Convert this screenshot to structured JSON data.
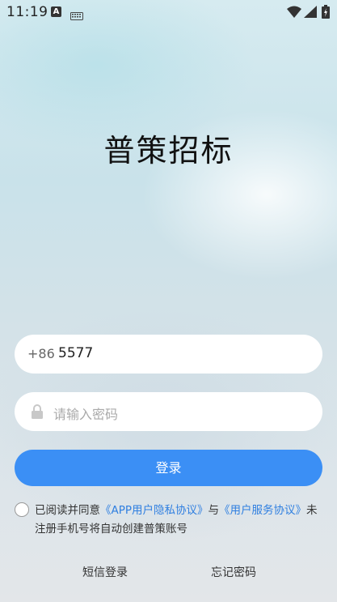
{
  "status_bar": {
    "time": "11:19",
    "app_icon_letter": "A",
    "icons": [
      "keyboard-icon",
      "wifi-icon",
      "signal-icon",
      "battery-icon"
    ]
  },
  "app_title": "普策招标",
  "phone_input": {
    "prefix": "+86",
    "value": "5577"
  },
  "password_input": {
    "placeholder": "请输入密码"
  },
  "login_button": "登录",
  "agreement": {
    "prefix": "已阅读并同意",
    "privacy_link": "《APP用户隐私协议》",
    "and": "与",
    "service_link": "《用户服务协议》",
    "suffix": "未注册手机号将自动创建普策账号"
  },
  "bottom_links": {
    "sms_login": "短信登录",
    "forgot_password": "忘记密码"
  },
  "colors": {
    "primary": "#3b8ff5",
    "link": "#2f7fe0"
  }
}
